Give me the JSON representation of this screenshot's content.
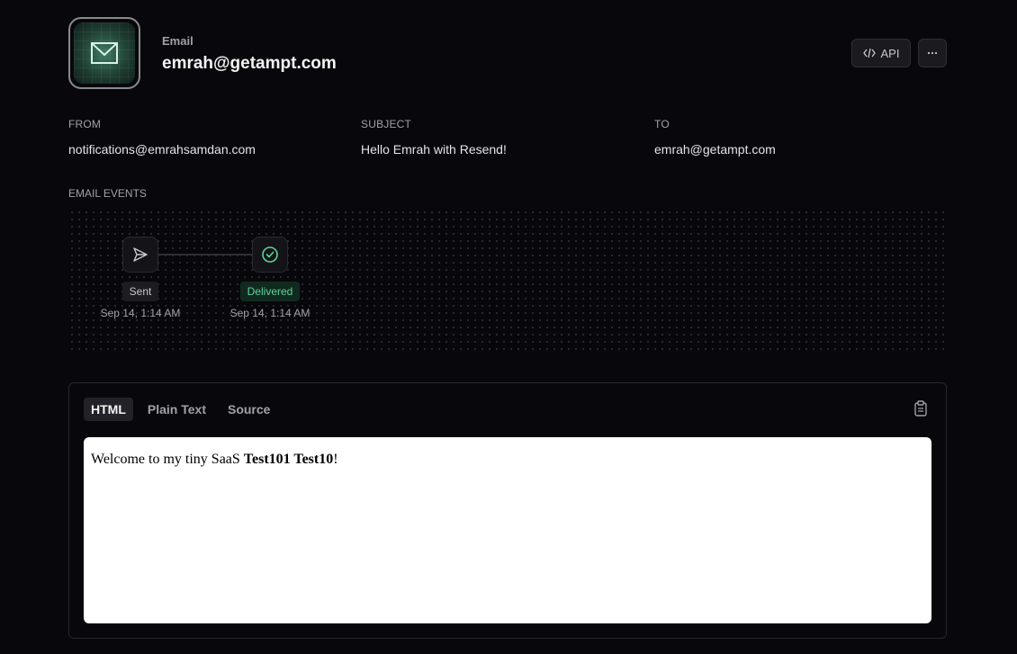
{
  "header": {
    "kicker": "Email",
    "title": "emrah@getampt.com",
    "icon": "envelope-icon",
    "actions": {
      "api_label": "API",
      "api_icon": "code-icon",
      "more_icon": "ellipsis-icon",
      "more_label": "···"
    }
  },
  "meta": {
    "from": {
      "label": "FROM",
      "value": "notifications@emrahsamdan.com"
    },
    "subject": {
      "label": "SUBJECT",
      "value": "Hello Emrah with Resend!"
    },
    "to": {
      "label": "TO",
      "value": "emrah@getampt.com"
    }
  },
  "events": {
    "label": "EMAIL EVENTS",
    "items": [
      {
        "status": "Sent",
        "time": "Sep 14, 1:14 AM",
        "icon": "send-icon"
      },
      {
        "status": "Delivered",
        "time": "Sep 14, 1:14 AM",
        "icon": "check-circle-icon",
        "color": "#5fd39b"
      }
    ]
  },
  "preview": {
    "tabs": [
      {
        "label": "HTML",
        "active": true
      },
      {
        "label": "Plain Text",
        "active": false
      },
      {
        "label": "Source",
        "active": false
      }
    ],
    "copy_icon": "clipboard-icon",
    "body": {
      "text_prefix": "Welcome to my tiny SaaS ",
      "bold_text": "Test101 Test10",
      "text_suffix": "!"
    }
  }
}
